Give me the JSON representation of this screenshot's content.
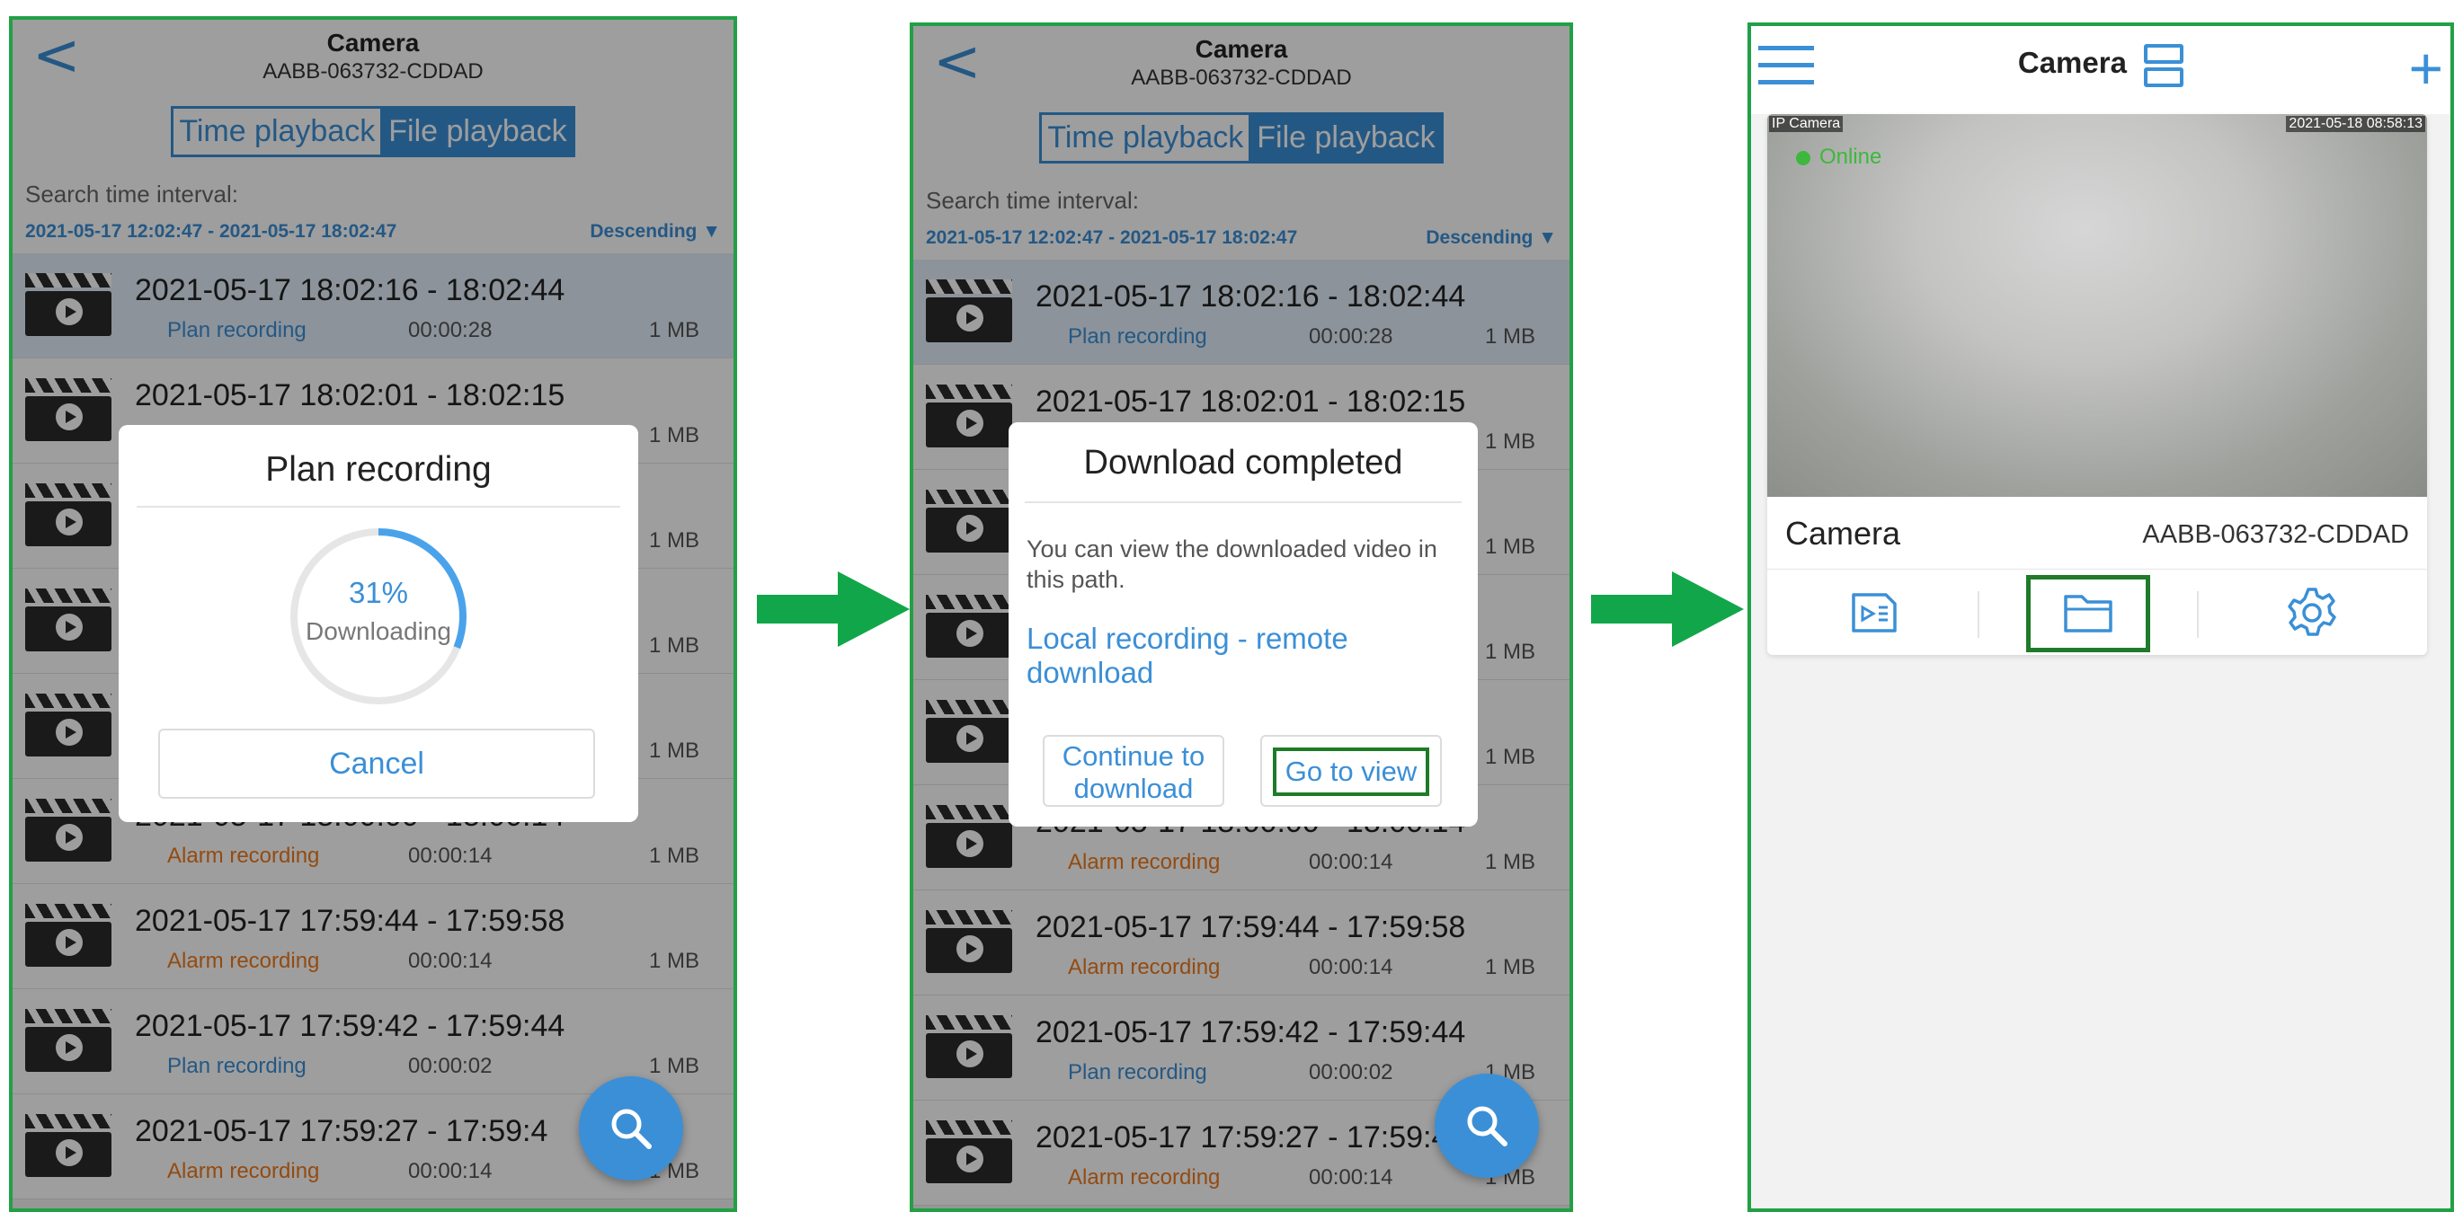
{
  "screen1": {
    "header": {
      "back": "<",
      "title": "Camera",
      "device_id": "AABB-063732-CDDAD"
    },
    "tabs": {
      "time": "Time playback",
      "file": "File playback"
    },
    "search": {
      "label": "Search time interval:",
      "range": "2021-05-17 12:02:47 - 2021-05-17 18:02:47",
      "sort": "Descending ▼"
    },
    "records": [
      {
        "time": "2021-05-17  18:02:16 - 18:02:44",
        "type": "Plan recording",
        "kind": "plan",
        "duration": "00:00:28",
        "size": "1 MB"
      },
      {
        "time": "2021-05-17  18:02:01 - 18:02:15",
        "type": "",
        "kind": "plan",
        "duration": "",
        "size": "1 MB"
      },
      {
        "time": "",
        "type": "",
        "kind": "plan",
        "duration": "",
        "size": "1 MB"
      },
      {
        "time": "",
        "type": "",
        "kind": "plan",
        "duration": "",
        "size": "1 MB"
      },
      {
        "time": "",
        "type": "",
        "kind": "plan",
        "duration": "",
        "size": "1 MB"
      },
      {
        "time": "2021-05-17  18:00:00 - 18:00:14",
        "type": "Alarm recording",
        "kind": "alarm",
        "duration": "00:00:14",
        "size": "1 MB"
      },
      {
        "time": "2021-05-17  17:59:44 - 17:59:58",
        "type": "Alarm recording",
        "kind": "alarm",
        "duration": "00:00:14",
        "size": "1 MB"
      },
      {
        "time": "2021-05-17  17:59:42 - 17:59:44",
        "type": "Plan recording",
        "kind": "plan",
        "duration": "00:00:02",
        "size": "1 MB"
      },
      {
        "time": "2021-05-17  17:59:27 - 17:59:4",
        "type": "Alarm recording",
        "kind": "alarm",
        "duration": "00:00:14",
        "size": "1 MB"
      }
    ],
    "dialog": {
      "title": "Plan recording",
      "percent_text": "31%",
      "progress": 0.31,
      "status": "Downloading",
      "cancel": "Cancel"
    }
  },
  "screen2": {
    "header": {
      "back": "<",
      "title": "Camera",
      "device_id": "AABB-063732-CDDAD"
    },
    "tabs": {
      "time": "Time playback",
      "file": "File playback"
    },
    "search": {
      "label": "Search time interval:",
      "range": "2021-05-17 12:02:47 - 2021-05-17 18:02:47",
      "sort": "Descending ▼"
    },
    "records": [
      {
        "time": "2021-05-17  18:02:16 - 18:02:44",
        "type": "Plan recording",
        "kind": "plan",
        "duration": "00:00:28",
        "size": "1 MB"
      },
      {
        "time": "2021-05-17  18:02:01 - 18:02:15",
        "type": "",
        "kind": "plan",
        "duration": "",
        "size": "1 MB"
      },
      {
        "time": "",
        "type": "",
        "kind": "plan",
        "duration": "",
        "size": "1 MB"
      },
      {
        "time": "",
        "type": "",
        "kind": "plan",
        "duration": "",
        "size": "1 MB"
      },
      {
        "time": "",
        "type": "",
        "kind": "plan",
        "duration": "",
        "size": "1 MB"
      },
      {
        "time": "2021-05-17  18:00:00 - 18:00:14",
        "type": "Alarm recording",
        "kind": "alarm",
        "duration": "00:00:14",
        "size": "1 MB"
      },
      {
        "time": "2021-05-17  17:59:44 - 17:59:58",
        "type": "Alarm recording",
        "kind": "alarm",
        "duration": "00:00:14",
        "size": "1 MB"
      },
      {
        "time": "2021-05-17  17:59:42 - 17:59:44",
        "type": "Plan recording",
        "kind": "plan",
        "duration": "00:00:02",
        "size": "1 MB"
      },
      {
        "time": "2021-05-17  17:59:27 - 17:59:4",
        "type": "Alarm recording",
        "kind": "alarm",
        "duration": "00:00:14",
        "size": "1 MB"
      }
    ],
    "dialog": {
      "title": "Download completed",
      "message": "You can view the downloaded video in this path.",
      "path": "Local recording - remote download",
      "continue": "Continue to download",
      "view": "Go to view"
    }
  },
  "screen3": {
    "header": {
      "title": "Camera"
    },
    "camera": {
      "osd_left": "IP Camera",
      "osd_right": "2021-05-18 08:58:13",
      "status": "Online",
      "name": "Camera",
      "device_id": "AABB-063732-CDDAD"
    },
    "actions": [
      "playback-icon",
      "folder-icon",
      "settings-icon"
    ]
  },
  "colors": {
    "accent": "#3b8fd6",
    "highlight": "#1f7a2a",
    "arrow": "#12a64a",
    "frame": "#22a045",
    "alarm": "#ee7a1c",
    "online": "#3db83d"
  }
}
